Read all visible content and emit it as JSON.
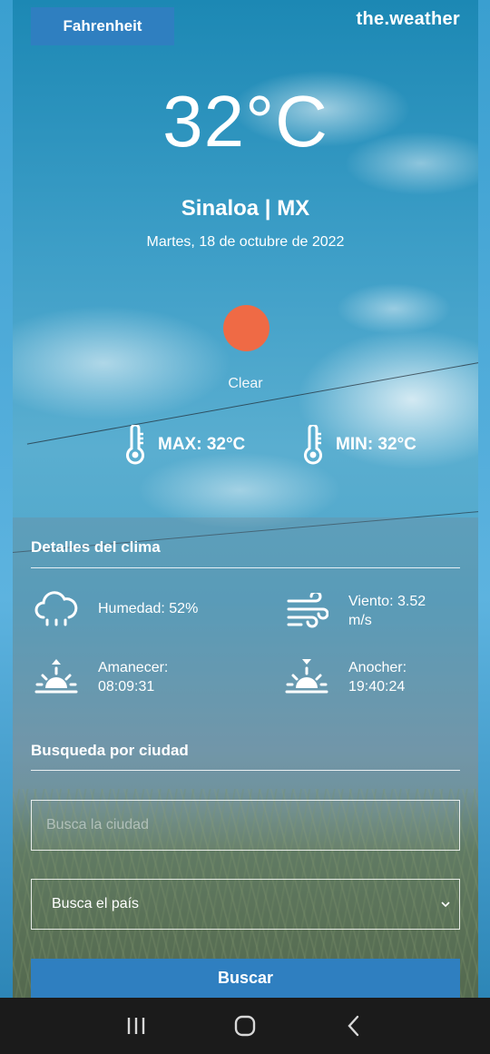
{
  "header": {
    "unit_toggle_label": "Fahrenheit",
    "brand": "the.weather"
  },
  "current": {
    "temperature": "32°C",
    "location": "Sinaloa | MX",
    "date": "Martes, 18 de octubre de 2022",
    "condition": "Clear",
    "condition_color": "#ef6a45",
    "max": "MAX: 32°C",
    "min": "MIN: 32°C"
  },
  "details": {
    "title": "Detalles del clima",
    "humidity": "Humedad: 52%",
    "wind_line1": "Viento: 3.52",
    "wind_line2": "m/s",
    "sunrise_line1": "Amanecer:",
    "sunrise_line2": "08:09:31",
    "sunset_line1": "Anocher:",
    "sunset_line2": "19:40:24"
  },
  "search": {
    "title": "Busqueda por ciudad",
    "city_placeholder": "Busca la ciudad",
    "country_selected": "Busca el país",
    "button_label": "Buscar"
  },
  "colors": {
    "accent": "#2f7fc0",
    "navbar": "#1b1b1b"
  },
  "icons": {
    "thermometer": "thermometer-icon",
    "humidity": "cloud-rain-icon",
    "wind": "wind-icon",
    "sunrise": "sunrise-icon",
    "sunset": "sunset-icon"
  }
}
